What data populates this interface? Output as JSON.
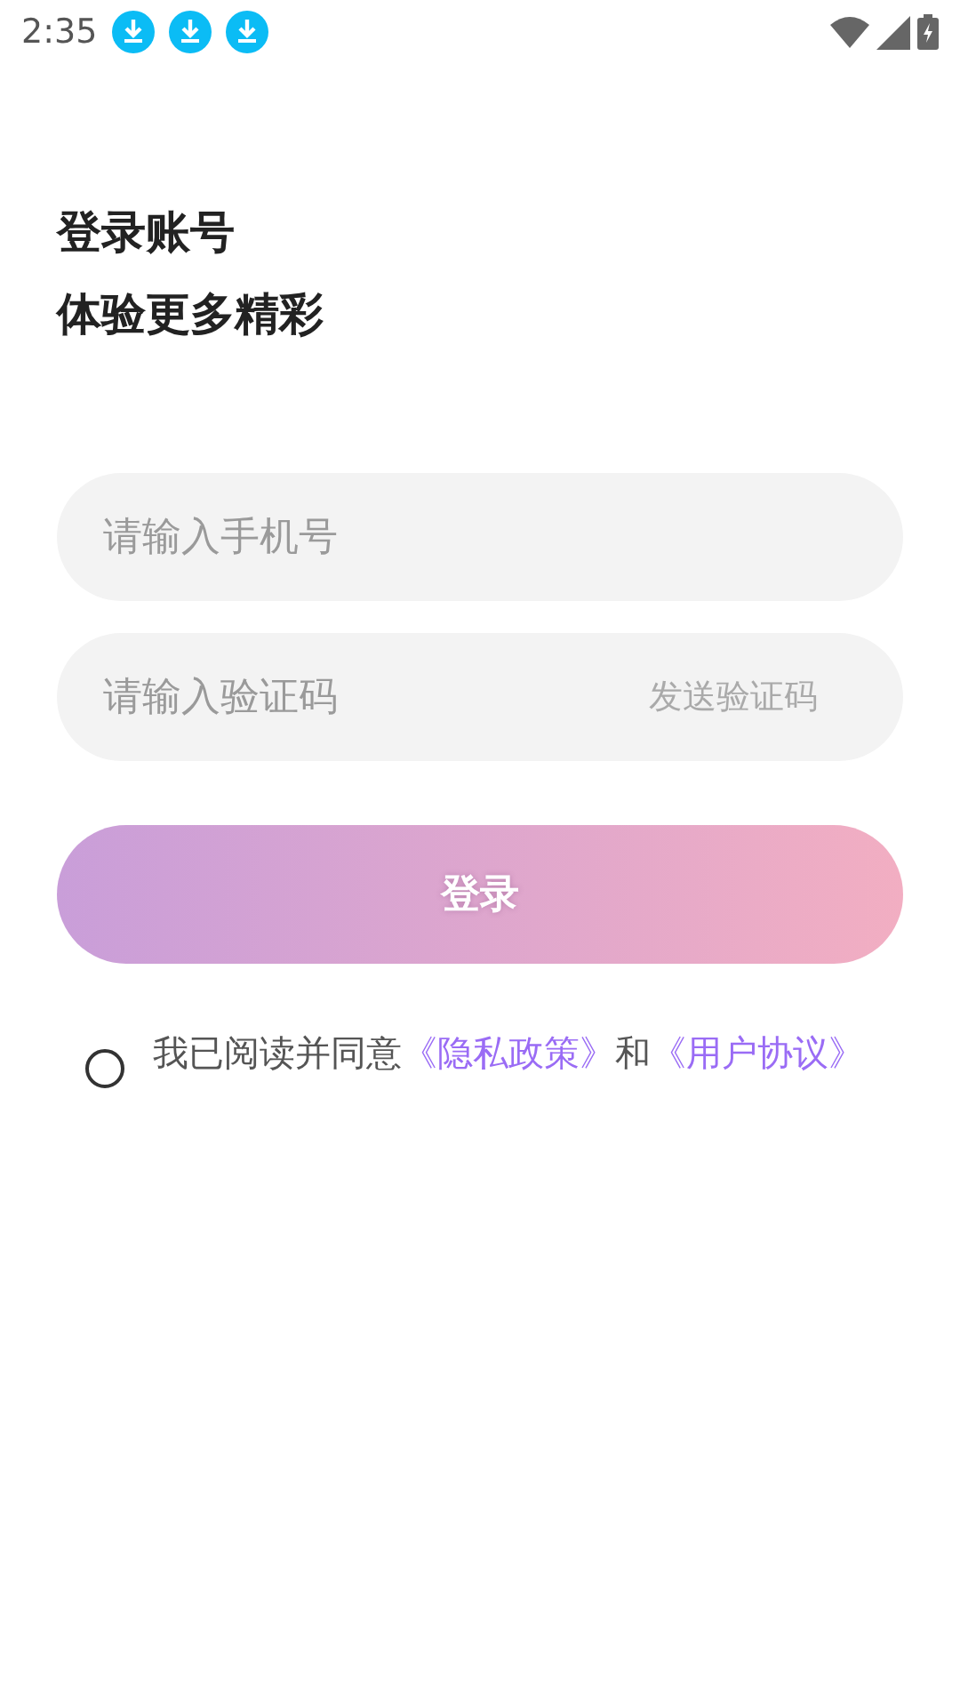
{
  "status_bar": {
    "time": "2:35",
    "notifications": [
      {
        "kind": "download"
      },
      {
        "kind": "download"
      },
      {
        "kind": "download"
      }
    ]
  },
  "heading": [
    "登录账号",
    "体验更多精彩"
  ],
  "phone_field": {
    "placeholder": "请输入手机号"
  },
  "code_field": {
    "placeholder": "请输入验证码",
    "action": "发送验证码"
  },
  "login_button": "登录",
  "agreement": {
    "checked": false,
    "parts": [
      {
        "kind": "text",
        "text": "我已阅读并同意"
      },
      {
        "kind": "link",
        "text": "《隐私政策》"
      },
      {
        "kind": "text",
        "text": "和"
      },
      {
        "kind": "link",
        "text": "《用户协议》"
      }
    ]
  }
}
